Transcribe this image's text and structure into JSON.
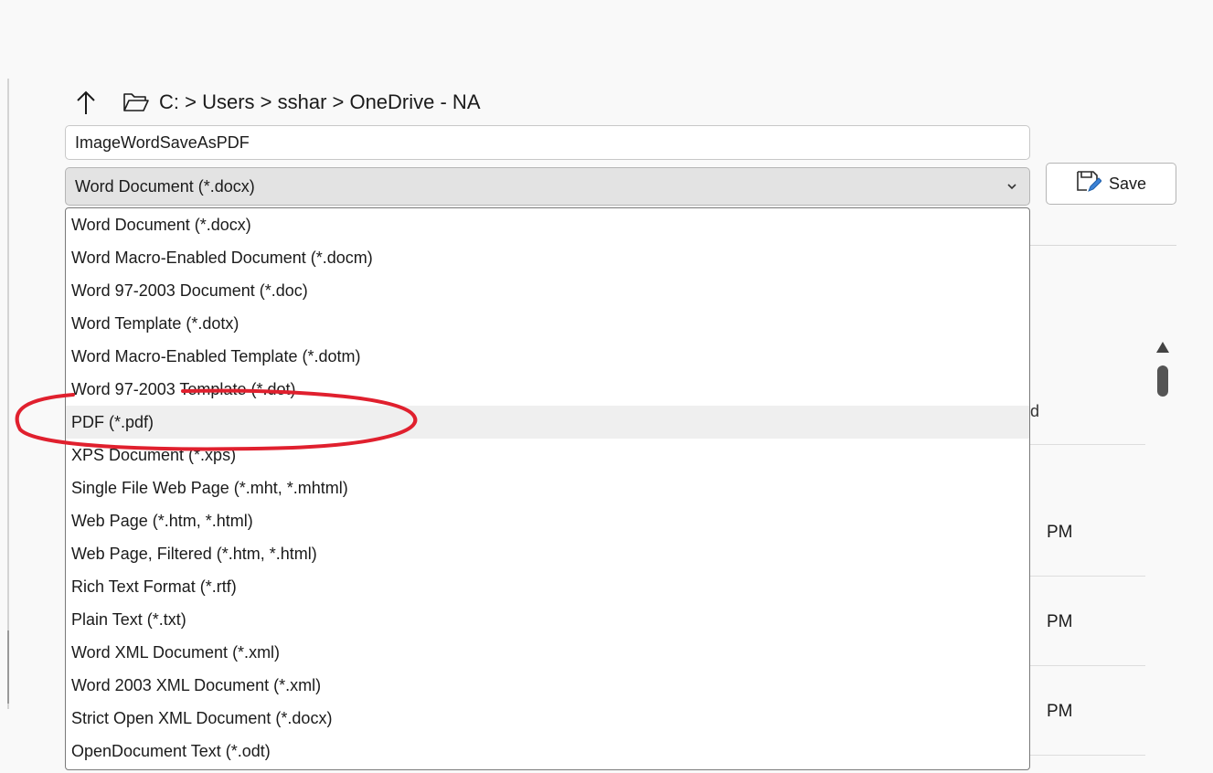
{
  "breadcrumb": {
    "path": "C: > Users > sshar > OneDrive - NA"
  },
  "filename": {
    "value": "ImageWordSaveAsPDF"
  },
  "filetype": {
    "selected": "Word Document (*.docx)",
    "options": [
      "Word Document (*.docx)",
      "Word Macro-Enabled Document (*.docm)",
      "Word 97-2003 Document (*.doc)",
      "Word Template (*.dotx)",
      "Word Macro-Enabled Template (*.dotm)",
      "Word 97-2003 Template (*.dot)",
      "PDF (*.pdf)",
      "XPS Document (*.xps)",
      "Single File Web Page (*.mht, *.mhtml)",
      "Web Page (*.htm, *.html)",
      "Web Page, Filtered (*.htm, *.html)",
      "Rich Text Format (*.rtf)",
      "Plain Text (*.txt)",
      "Word XML Document (*.xml)",
      "Word 2003 XML Document (*.xml)",
      "Strict Open XML Document (*.docx)",
      "OpenDocument Text (*.odt)"
    ],
    "highlighted": "PDF (*.pdf)"
  },
  "save_button": {
    "label": "Save",
    "icon": "save-icon"
  },
  "background": {
    "column_fragment": "d",
    "times": [
      "PM",
      "PM",
      "PM"
    ]
  },
  "colors": {
    "annotation": "#e0202e",
    "highlight": "#efefef"
  }
}
